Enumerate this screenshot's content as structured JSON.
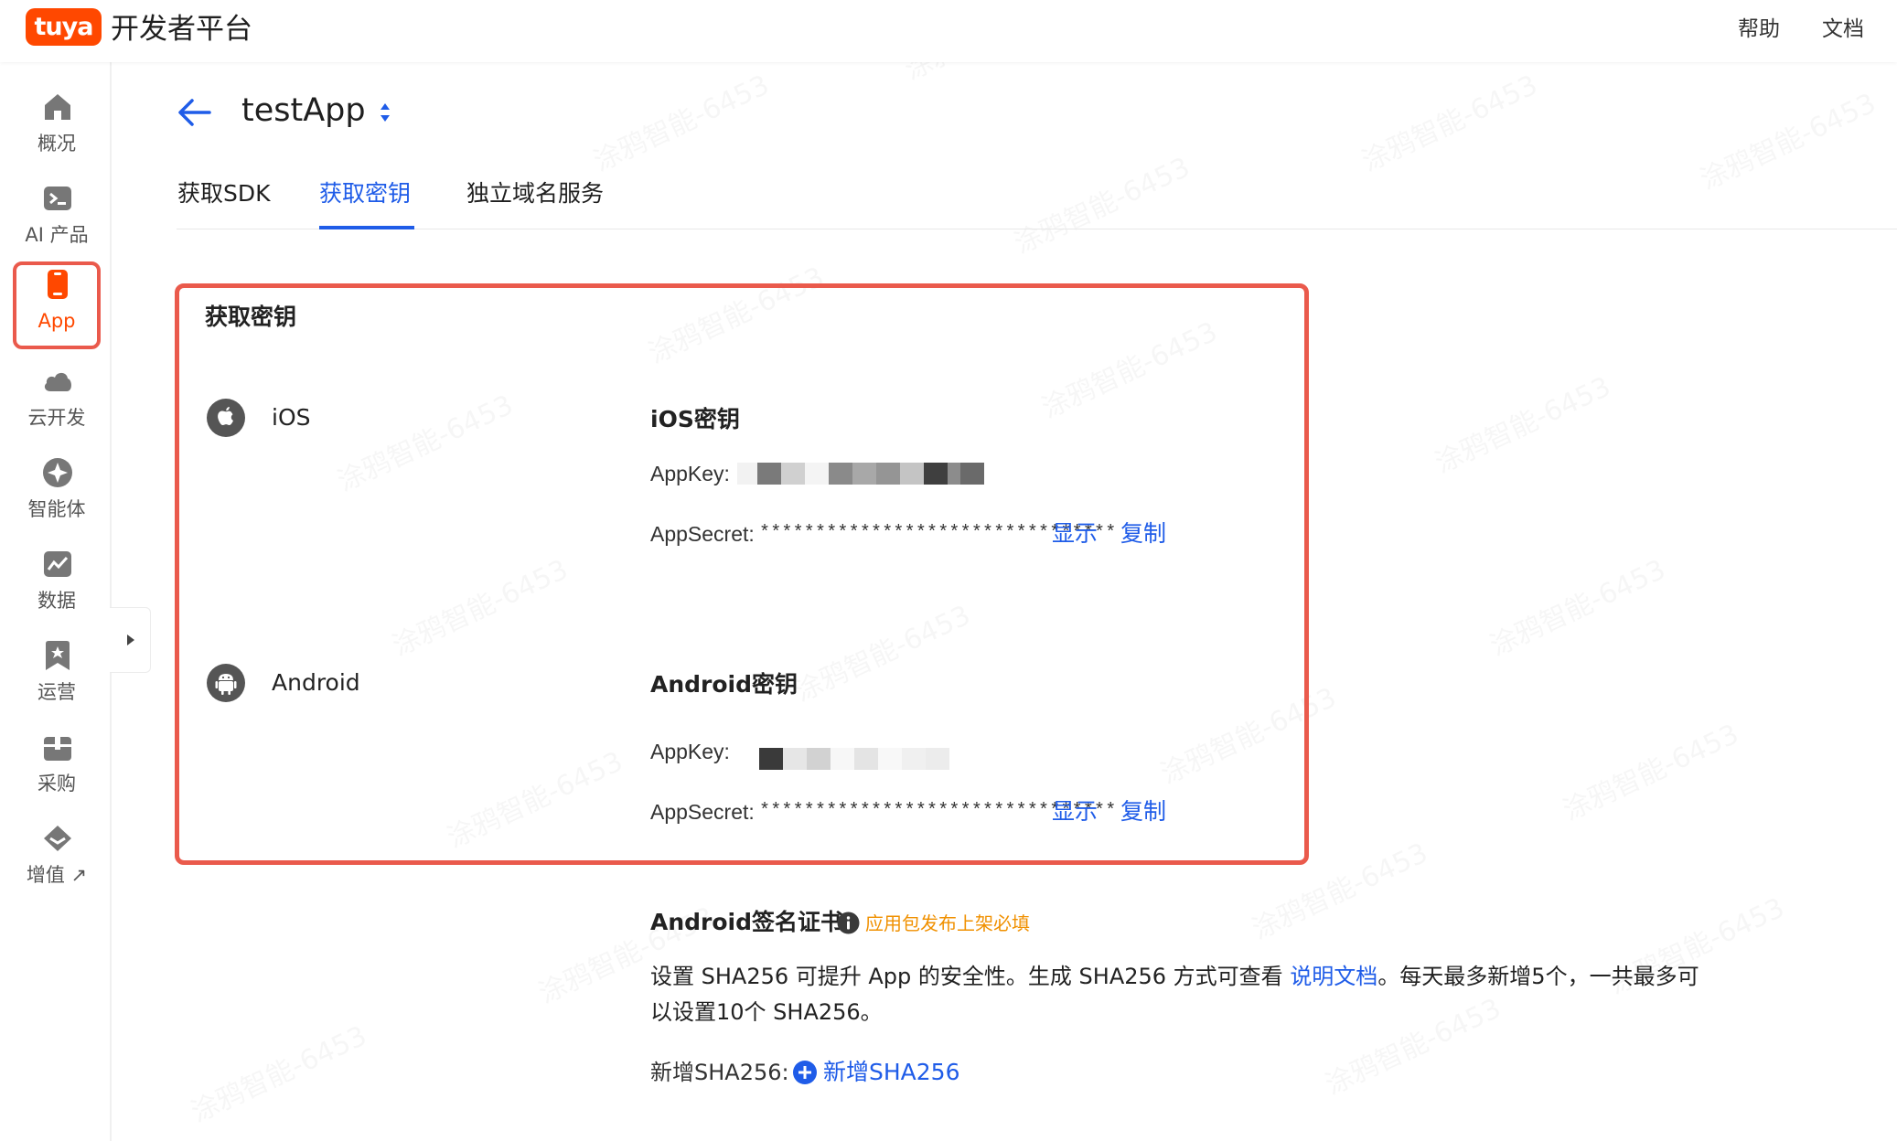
{
  "header": {
    "logo_text": "tuya",
    "platform_name": "开发者平台",
    "links": [
      "帮助",
      "文档"
    ]
  },
  "sidebar": {
    "items": [
      {
        "label": "概况",
        "icon": "home-icon"
      },
      {
        "label": "AI 产品",
        "icon": "terminal-icon"
      },
      {
        "label": "App",
        "icon": "phone-icon",
        "active": true
      },
      {
        "label": "云开发",
        "icon": "cloud-icon"
      },
      {
        "label": "智能体",
        "icon": "sparkle-icon"
      },
      {
        "label": "数据",
        "icon": "chart-icon"
      },
      {
        "label": "运营",
        "icon": "bookmark-star-icon"
      },
      {
        "label": "采购",
        "icon": "box-icon"
      },
      {
        "label": "增值 ↗",
        "icon": "diamond-icon"
      }
    ]
  },
  "page": {
    "app_name": "testApp",
    "tabs": [
      {
        "label": "获取SDK",
        "active": false
      },
      {
        "label": "获取密钥",
        "active": true
      },
      {
        "label": "独立域名服务",
        "active": false
      }
    ]
  },
  "keys_card": {
    "title": "获取密钥",
    "ios": {
      "platform": "iOS",
      "section_title": "iOS密钥",
      "appkey_label": "AppKey:",
      "appsecret_label": "AppSecret:",
      "appsecret_masked": "********************************",
      "show_label": "显示",
      "copy_label": "复制"
    },
    "android": {
      "platform": "Android",
      "section_title": "Android密钥",
      "appkey_label": "AppKey:",
      "appsecret_label": "AppSecret:",
      "appsecret_masked": "********************************",
      "show_label": "显示",
      "copy_label": "复制"
    }
  },
  "cert": {
    "title": "Android签名证书",
    "required_tag": "应用包发布上架必填",
    "desc_before_link": "设置 SHA256 可提升 App 的安全性。生成 SHA256 方式可查看 ",
    "desc_link": "说明文档",
    "desc_after_link": "。每天最多新增5个，一共最多可以设置10个 SHA256。",
    "add_label": "新增SHA256:",
    "add_link": "新增SHA256"
  },
  "colors": {
    "brand": "#ff4800",
    "link": "#1f5ce8",
    "highlight_border": "#ea5a4c",
    "warning": "#f09000"
  }
}
